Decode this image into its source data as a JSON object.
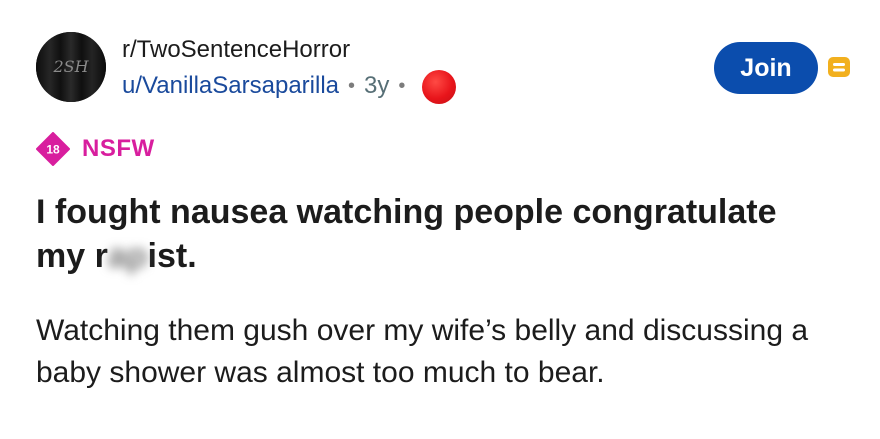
{
  "post": {
    "avatar_text": "2SH",
    "subreddit": "r/TwoSentenceHorror",
    "username": "u/VanillaSarsaparilla",
    "separator": "•",
    "age": "3y",
    "join_label": "Join",
    "nsfw_age": "18",
    "nsfw_label": "NSFW",
    "title_before": "I fought nausea watching people congratulate my r",
    "title_censored": "ap",
    "title_after": "ist.",
    "body": "Watching them gush over my wife’s belly and discussing a baby shower was almost too much to bear."
  },
  "colors": {
    "join_button": "#0b4dad",
    "nsfw": "#d81e9e",
    "username": "#1a4a9c",
    "award_badge": "#e8151b",
    "archive_icon": "#f2b01e"
  },
  "icons": {
    "archive": "archive-icon",
    "nsfw": "nsfw-18-icon",
    "award": "award-badge-icon"
  }
}
